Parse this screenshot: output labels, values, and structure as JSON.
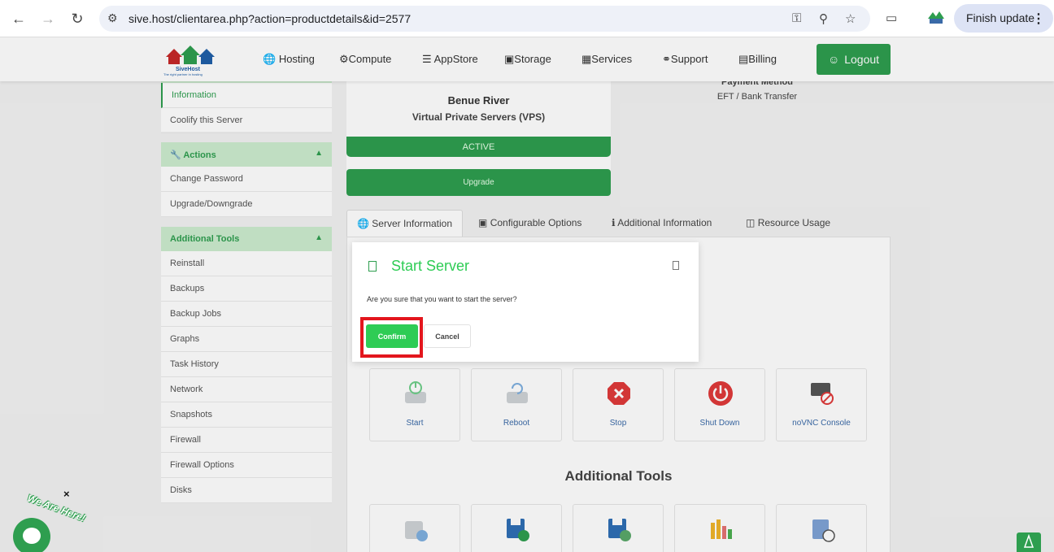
{
  "browser": {
    "url": "sive.host/clientarea.php?action=productdetails&id=2577",
    "finish_update": "Finish update"
  },
  "logo": {
    "brand": "SiveHost",
    "tagline": "The right partner in hosting"
  },
  "nav": {
    "items": [
      "Hosting",
      "Compute",
      "AppStore",
      "Storage",
      "Services",
      "Support",
      "Billing"
    ],
    "logout": "Logout"
  },
  "sidebar": {
    "info_items": [
      "Information",
      "Coolify this Server"
    ],
    "actions_header": "Actions",
    "actions_items": [
      "Change Password",
      "Upgrade/Downgrade"
    ],
    "tools_header": "Additional Tools",
    "tools_items": [
      "Reinstall",
      "Backups",
      "Backup Jobs",
      "Graphs",
      "Task History",
      "Network",
      "Snapshots",
      "Firewall",
      "Firewall Options",
      "Disks"
    ]
  },
  "product": {
    "name": "Benue River",
    "group": "Virtual Private Servers (VPS)",
    "status": "ACTIVE",
    "upgrade": "Upgrade",
    "payment_title": "Payment Method",
    "payment_value": "EFT / Bank Transfer"
  },
  "tabs": [
    "Server Information",
    "Configurable Options",
    "Additional Information",
    "Resource Usage"
  ],
  "actions": [
    "Start",
    "Reboot",
    "Stop",
    "Shut Down",
    "noVNC Console"
  ],
  "additional_tools_title": "Additional Tools",
  "modal": {
    "title": "Start Server",
    "text": "Are you sure that you want to start the server?",
    "confirm": "Confirm",
    "cancel": "Cancel"
  },
  "chat": {
    "tag": "We Are Here!",
    "close": "×"
  },
  "colors": {
    "brand_green": "#2e9e4f",
    "modal_green": "#2ecc55",
    "highlight_red": "#e3161d"
  }
}
